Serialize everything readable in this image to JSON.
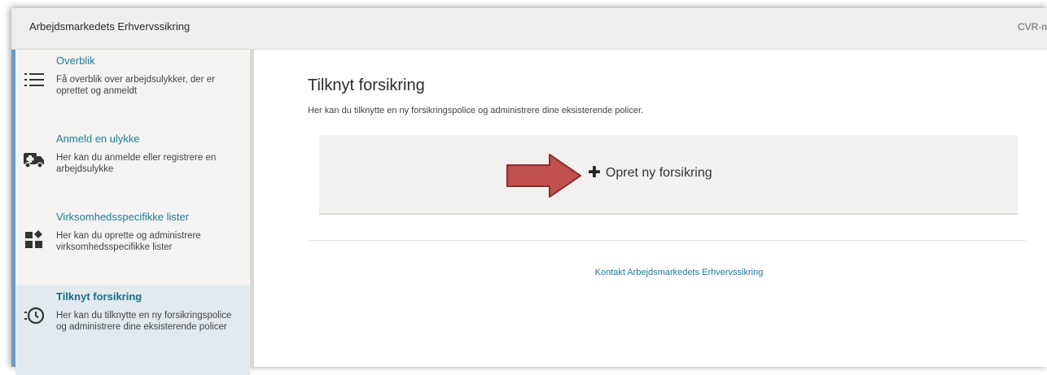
{
  "header": {
    "app_title": "Arbejdsmarkedets Erhvervssikring",
    "cvr_label": "CVR-n"
  },
  "sidebar": {
    "items": [
      {
        "title": "Overblik",
        "desc": "Få overblik over arbejdsulykker, der er oprettet og anmeldt",
        "icon": "list-icon",
        "active": false
      },
      {
        "title": "Anmeld en ulykke",
        "desc": "Her kan du anmelde eller registrere en arbejdsulykke",
        "icon": "ambulance-icon",
        "active": false
      },
      {
        "title": "Virksomhedsspecifikke lister",
        "desc": "Her kan du oprette og administrere virksomhedsspecifikke lister",
        "icon": "blocks-icon",
        "active": false
      },
      {
        "title": "Tilknyt forsikring",
        "desc": "Her kan du tilknytte en ny forsikringspolice og administrere dine eksisterende policer",
        "icon": "history-clock-icon",
        "active": true
      }
    ]
  },
  "main": {
    "title": "Tilknyt forsikring",
    "subtitle": "Her kan du tilknytte en ny forsikringspolice og administrere dine eksisterende policer.",
    "create_label": "Opret ny forsikring",
    "contact_link": "Kontakt Arbejdsmarkedets Erhvervssikring"
  },
  "colors": {
    "link": "#1f7a9a",
    "arrow_fill": "#c0504d",
    "arrow_stroke": "#8c2f2c",
    "active_bg": "#e2eaef"
  }
}
